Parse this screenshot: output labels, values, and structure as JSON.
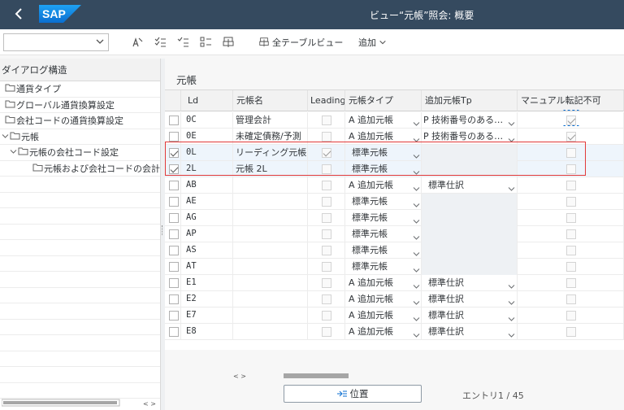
{
  "title_bar": {
    "back": "<",
    "logo": "SAP",
    "title": "ビュー“元帳”照会: 概要"
  },
  "toolbar": {
    "select_value": "",
    "full_table_view": "全テーブルビュー",
    "add": "追加"
  },
  "tree": {
    "header": "ダイアログ構造",
    "items": [
      {
        "label": "通貨タイプ"
      },
      {
        "label": "グローバル通貨換算設定"
      },
      {
        "label": "会社コードの通貨換算設定"
      },
      {
        "label": "元帳"
      },
      {
        "label": "元帳の会社コード設定"
      },
      {
        "label": "元帳および会社コードの会計原"
      }
    ]
  },
  "panel": {
    "title": "元帳",
    "columns": [
      "Ld",
      "元帳名",
      "Leading",
      "元帳タイプ",
      "追加元帳Tp",
      "マニュアル転記不可"
    ],
    "rows": [
      {
        "sel": false,
        "ld": "0C",
        "name": "管理会計",
        "leading": false,
        "type": "A 追加元帳",
        "add_tp": "P 技術番号のある…",
        "manual": true
      },
      {
        "sel": false,
        "ld": "0E",
        "name": "未確定債務/予測",
        "leading": false,
        "type": "A 追加元帳",
        "add_tp": "P 技術番号のある…",
        "manual": true
      },
      {
        "sel": true,
        "ld": "0L",
        "name": "リーディング元帳",
        "leading": true,
        "type": "標準元帳",
        "add_tp": "",
        "manual": false
      },
      {
        "sel": true,
        "ld": "2L",
        "name": "元帳 2L",
        "leading": false,
        "type": "標準元帳",
        "add_tp": "",
        "manual": false
      },
      {
        "sel": false,
        "ld": "AB",
        "name": "",
        "leading": false,
        "type": "A 追加元帳",
        "add_tp": "標準仕訳",
        "manual": false
      },
      {
        "sel": false,
        "ld": "AE",
        "name": "",
        "leading": false,
        "type": "標準元帳",
        "add_tp": "",
        "manual": false
      },
      {
        "sel": false,
        "ld": "AG",
        "name": "",
        "leading": false,
        "type": "標準元帳",
        "add_tp": "",
        "manual": false
      },
      {
        "sel": false,
        "ld": "AP",
        "name": "",
        "leading": false,
        "type": "標準元帳",
        "add_tp": "",
        "manual": false
      },
      {
        "sel": false,
        "ld": "AS",
        "name": "",
        "leading": false,
        "type": "標準元帳",
        "add_tp": "",
        "manual": false
      },
      {
        "sel": false,
        "ld": "AT",
        "name": "",
        "leading": false,
        "type": "標準元帳",
        "add_tp": "",
        "manual": false
      },
      {
        "sel": false,
        "ld": "E1",
        "name": "",
        "leading": false,
        "type": "A 追加元帳",
        "add_tp": "標準仕訳",
        "manual": false
      },
      {
        "sel": false,
        "ld": "E2",
        "name": "",
        "leading": false,
        "type": "A 追加元帳",
        "add_tp": "標準仕訳",
        "manual": false
      },
      {
        "sel": false,
        "ld": "E7",
        "name": "",
        "leading": false,
        "type": "A 追加元帳",
        "add_tp": "標準仕訳",
        "manual": false
      },
      {
        "sel": false,
        "ld": "E8",
        "name": "",
        "leading": false,
        "type": "A 追加元帳",
        "add_tp": "標準仕訳",
        "manual": false
      }
    ],
    "position_button": "位置",
    "entry": "エントリ1 / 45"
  }
}
